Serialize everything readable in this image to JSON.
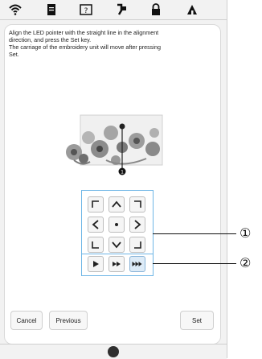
{
  "message": {
    "line1": "Align the LED pointer with the straight line in the alignment",
    "line2": "direction, and press the Set key.",
    "line3": "The carriage of the embroidery unit will move after pressing",
    "line4": "Set."
  },
  "preview": {
    "marker_label": "1"
  },
  "callouts": {
    "one": "①",
    "two": "②"
  },
  "buttons": {
    "cancel": "Cancel",
    "previous": "Previous",
    "set": "Set"
  },
  "icons": {
    "top": [
      "wifi-icon",
      "document-icon",
      "help-icon",
      "thread-icon",
      "lock-icon",
      "home-icon"
    ],
    "move_keys": [
      "up-left-corner-icon",
      "up-arrow-icon",
      "up-right-corner-icon",
      "left-arrow-icon",
      "center-dot-icon",
      "right-arrow-icon",
      "down-left-corner-icon",
      "down-arrow-icon",
      "down-right-corner-icon"
    ],
    "speed_keys": [
      "speed-slow-icon",
      "speed-medium-icon",
      "speed-fast-icon"
    ]
  },
  "colors": {
    "highlight_border": "#6fb6e6",
    "selected_speed": "#ddebf7"
  }
}
